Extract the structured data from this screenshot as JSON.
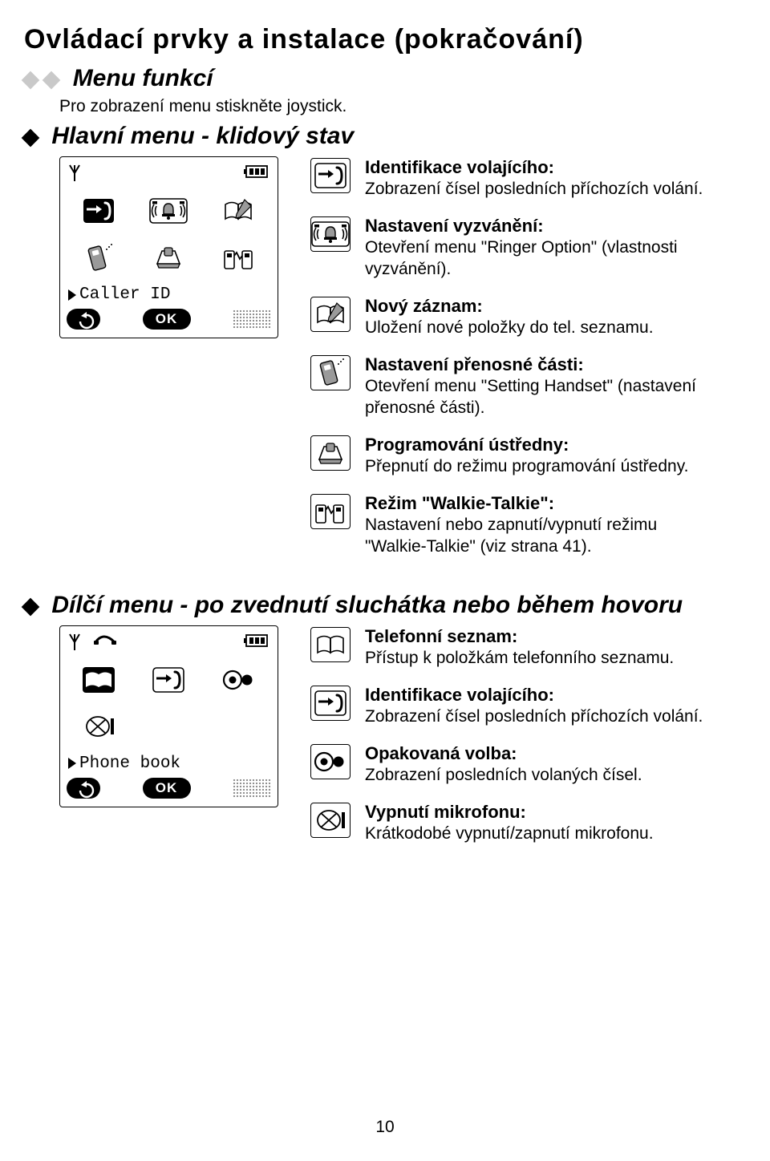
{
  "page_number": "10",
  "heading": "Ovládací prvky a instalace (pokračování)",
  "menu_funkci": {
    "title": "Menu funkcí",
    "intro": "Pro zobrazení menu stiskněte joystick."
  },
  "hlavni_menu": {
    "title": "Hlavní menu - klidový stav",
    "display_caption": "Caller ID",
    "ok_label": "OK",
    "items": [
      {
        "title": "Identifikace volajícího:",
        "desc": "Zobrazení čísel posledních příchozích volání."
      },
      {
        "title": "Nastavení vyzvánění:",
        "desc": "Otevření menu \"Ringer Option\" (vlastnosti vyzvánění)."
      },
      {
        "title": "Nový záznam:",
        "desc": "Uložení nové položky do tel. seznamu."
      },
      {
        "title": "Nastavení přenosné části:",
        "desc": "Otevření menu \"Setting Handset\" (nastavení přenosné části)."
      },
      {
        "title": "Programování ústředny:",
        "desc": "Přepnutí do režimu programování ústředny."
      },
      {
        "title": "Režim \"Walkie-Talkie\":",
        "desc": "Nastavení nebo zapnutí/vypnutí režimu \"Walkie-Talkie\" (viz strana 41)."
      }
    ]
  },
  "dilci_menu": {
    "title": "Dílčí menu - po zvednutí sluchátka nebo během hovoru",
    "display_caption": "Phone book",
    "ok_label": "OK",
    "items": [
      {
        "title": "Telefonní seznam:",
        "desc": "Přístup k položkám telefonního seznamu."
      },
      {
        "title": "Identifikace volajícího:",
        "desc": "Zobrazení čísel posledních příchozích volání."
      },
      {
        "title": "Opakovaná volba:",
        "desc": "Zobrazení posledních volaných čísel."
      },
      {
        "title": "Vypnutí mikrofonu:",
        "desc": "Krátkodobé vypnutí/zapnutí mikrofonu."
      }
    ]
  }
}
